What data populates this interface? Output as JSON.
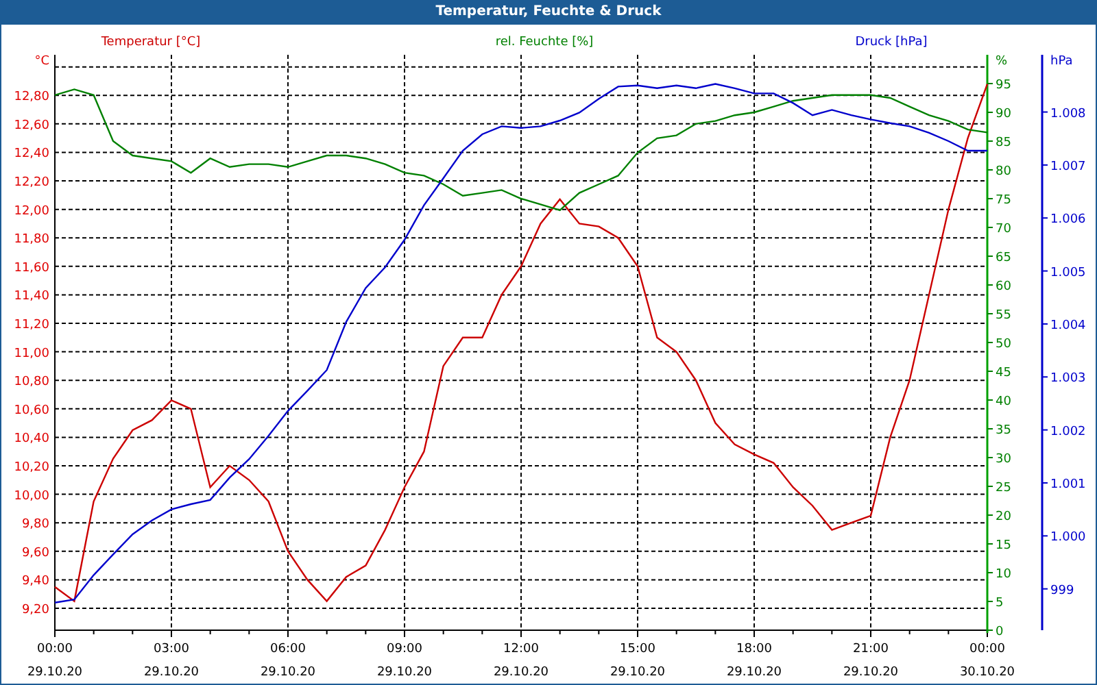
{
  "window": {
    "title": "Temperatur, Feuchte & Druck"
  },
  "chart": {
    "chart_data": {
      "type": "line",
      "xlim": [
        0,
        24
      ],
      "x": [
        0,
        0.5,
        1,
        1.5,
        2,
        2.5,
        3,
        3.5,
        4,
        4.5,
        5,
        5.5,
        6,
        6.5,
        7,
        7.5,
        8,
        8.5,
        9,
        9.5,
        10,
        10.5,
        11,
        11.5,
        12,
        12.5,
        13,
        13.5,
        14,
        14.5,
        15,
        15.5,
        16,
        16.5,
        17,
        17.5,
        18,
        18.5,
        19,
        19.5,
        20,
        20.5,
        21,
        21.5,
        22,
        22.5,
        23,
        23.5,
        24
      ],
      "grid": true,
      "xticks": [
        {
          "value": 0,
          "label": "00:00"
        },
        {
          "value": 3,
          "label": "03:00"
        },
        {
          "value": 6,
          "label": "06:00"
        },
        {
          "value": 9,
          "label": "09:00"
        },
        {
          "value": 12,
          "label": "12:00"
        },
        {
          "value": 15,
          "label": "15:00"
        },
        {
          "value": 18,
          "label": "18:00"
        },
        {
          "value": 21,
          "label": "21:00"
        },
        {
          "value": 24,
          "label": "00:00"
        }
      ],
      "ylabel": "°C",
      "ylim": [
        9.046,
        13.085
      ],
      "yticks": [
        {
          "value": 9.2,
          "label": "9,20"
        },
        {
          "value": 9.4,
          "label": "9,40"
        },
        {
          "value": 9.6,
          "label": "9,60"
        },
        {
          "value": 9.8,
          "label": "9,80"
        },
        {
          "value": 10.0,
          "label": "10,00"
        },
        {
          "value": 10.2,
          "label": "10,20"
        },
        {
          "value": 10.4,
          "label": "10,40"
        },
        {
          "value": 10.6,
          "label": "10,60"
        },
        {
          "value": 10.8,
          "label": "10,80"
        },
        {
          "value": 11.0,
          "label": "11,00"
        },
        {
          "value": 11.2,
          "label": "11,20"
        },
        {
          "value": 11.4,
          "label": "11,40"
        },
        {
          "value": 11.6,
          "label": "11,60"
        },
        {
          "value": 11.8,
          "label": "11,80"
        },
        {
          "value": 12.0,
          "label": "12,00"
        },
        {
          "value": 12.2,
          "label": "12,20"
        },
        {
          "value": 12.4,
          "label": "12,40"
        },
        {
          "value": 12.6,
          "label": "12,60"
        },
        {
          "value": 12.8,
          "label": "12,80"
        }
      ],
      "y2label": "%",
      "y2lim": [
        0,
        100
      ],
      "y2ticks": [
        {
          "value": 0,
          "label": "0"
        },
        {
          "value": 5,
          "label": "5"
        },
        {
          "value": 10,
          "label": "10"
        },
        {
          "value": 15,
          "label": "15"
        },
        {
          "value": 20,
          "label": "20"
        },
        {
          "value": 25,
          "label": "25"
        },
        {
          "value": 30,
          "label": "30"
        },
        {
          "value": 35,
          "label": "35"
        },
        {
          "value": 40,
          "label": "40"
        },
        {
          "value": 45,
          "label": "45"
        },
        {
          "value": 50,
          "label": "50"
        },
        {
          "value": 55,
          "label": "55"
        },
        {
          "value": 60,
          "label": "60"
        },
        {
          "value": 65,
          "label": "65"
        },
        {
          "value": 70,
          "label": "70"
        },
        {
          "value": 75,
          "label": "75"
        },
        {
          "value": 80,
          "label": "80"
        },
        {
          "value": 85,
          "label": "85"
        },
        {
          "value": 90,
          "label": "90"
        },
        {
          "value": 95,
          "label": "95"
        }
      ],
      "y3label": "hPa",
      "y3lim": [
        998.22,
        1009.08
      ],
      "y3ticks": [
        {
          "value": 999,
          "label": "999"
        },
        {
          "value": 1000,
          "label": "1.000"
        },
        {
          "value": 1001,
          "label": "1.001"
        },
        {
          "value": 1002,
          "label": "1.002"
        },
        {
          "value": 1003,
          "label": "1.003"
        },
        {
          "value": 1004,
          "label": "1.004"
        },
        {
          "value": 1005,
          "label": "1.005"
        },
        {
          "value": 1006,
          "label": "1.006"
        },
        {
          "value": 1007,
          "label": "1.007"
        },
        {
          "value": 1008,
          "label": "1.008"
        }
      ],
      "series": [
        {
          "name": "Temperatur [°C]",
          "color": "#cc0000",
          "axis": "y",
          "values": [
            9.35,
            9.25,
            9.95,
            10.25,
            10.45,
            10.52,
            10.66,
            10.6,
            10.05,
            10.2,
            10.1,
            9.95,
            9.6,
            9.4,
            9.25,
            9.42,
            9.5,
            9.75,
            10.05,
            10.3,
            10.9,
            11.1,
            11.1,
            11.4,
            11.6,
            11.9,
            12.07,
            11.9,
            11.88,
            11.8,
            11.6,
            11.1,
            11.0,
            10.8,
            10.5,
            10.35,
            10.28,
            10.22,
            10.05,
            9.92,
            9.75,
            9.8,
            9.85,
            10.4,
            10.8,
            11.4,
            12.0,
            12.5,
            12.88
          ]
        },
        {
          "name": "rel. Feuchte [%]",
          "color": "#008000",
          "axis": "y2",
          "values": [
            93,
            94,
            93,
            85,
            82.5,
            82,
            81.5,
            79.5,
            82,
            80.5,
            81,
            81,
            80.5,
            81.5,
            82.5,
            82.5,
            82,
            81,
            79.5,
            79,
            77.5,
            75.5,
            76,
            76.5,
            75,
            74,
            73,
            76,
            77.5,
            79,
            83,
            85.5,
            86,
            88,
            88.5,
            89.5,
            90,
            91,
            92,
            92.5,
            93,
            93,
            93,
            92.5,
            91,
            89.5,
            88.5,
            87,
            86.5
          ]
        },
        {
          "name": "Druck [hPa]",
          "color": "#0000cc",
          "axis": "y3",
          "values": [
            998.74,
            998.8,
            999.26,
            999.65,
            1000.03,
            1000.29,
            1000.5,
            1000.6,
            1000.68,
            1001.1,
            1001.45,
            1001.89,
            1002.36,
            1002.74,
            1003.13,
            1004.04,
            1004.68,
            1005.07,
            1005.59,
            1006.24,
            1006.75,
            1007.27,
            1007.58,
            1007.73,
            1007.7,
            1007.73,
            1007.84,
            1007.99,
            1008.25,
            1008.48,
            1008.5,
            1008.45,
            1008.5,
            1008.45,
            1008.53,
            1008.45,
            1008.35,
            1008.35,
            1008.17,
            1007.94,
            1008.04,
            1007.94,
            1007.86,
            1007.79,
            1007.73,
            1007.61,
            1007.45,
            1007.27,
            1007.27
          ]
        }
      ]
    },
    "x_dates": [
      "29.10.20",
      "29.10.20",
      "29.10.20",
      "29.10.20",
      "29.10.20",
      "29.10.20",
      "29.10.20",
      "29.10.20",
      "30.10.20"
    ]
  }
}
